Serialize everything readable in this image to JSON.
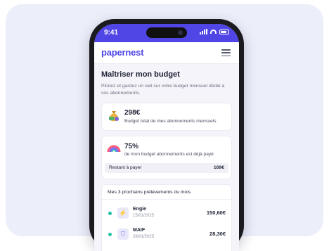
{
  "status": {
    "time": "9:41"
  },
  "app": {
    "logo": "papernest"
  },
  "budget": {
    "title": "Maîtriser mon budget",
    "description": "Pilotez et gardez un oeil sur votre budget mensuel dédié à vos abonnements."
  },
  "total_card": {
    "amount": "298€",
    "label": "Budget total de mes abonnements mensuels",
    "icon": "money-bag-icon"
  },
  "paid_card": {
    "percent": "75%",
    "label": "de mon budget abonnements est déjà payé",
    "remaining_label": "Restant à payer",
    "remaining_value": "169€",
    "icon": "rainbow-gauge-icon",
    "paid_fraction": 0.75
  },
  "upcoming": {
    "title": "Mes 3 prochains prélèvements du mois",
    "items": [
      {
        "name": "Engie",
        "date": "15/01/2025",
        "amount": "150,60€",
        "icon": "lightning-icon"
      },
      {
        "name": "MAIF",
        "date": "28/01/2025",
        "amount": "28,30€",
        "icon": "shield-icon"
      }
    ]
  },
  "colors": {
    "accent": "#4f46e5",
    "status_dot": "#22c3a5"
  }
}
